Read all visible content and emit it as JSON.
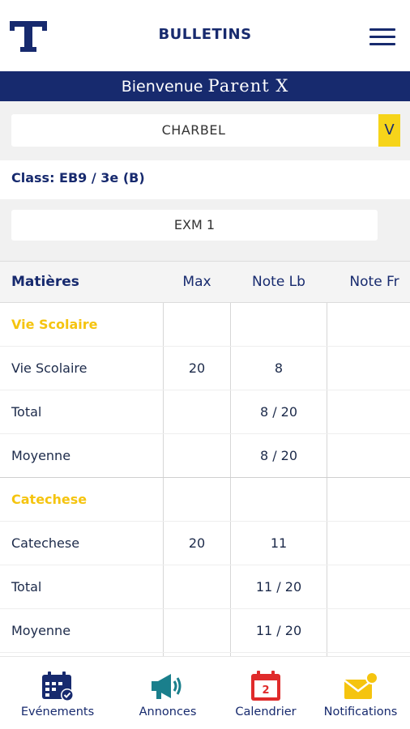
{
  "header": {
    "title": "BULLETINS"
  },
  "welcome": {
    "prefix": "Bienvenue",
    "name": "Parent X"
  },
  "student_select": {
    "value": "CHARBEL",
    "arrow": "V"
  },
  "class_info": "Class: EB9 / 3e (B)",
  "exam_select": {
    "value": "EXM 1"
  },
  "table": {
    "headers": {
      "subject": "Matières",
      "max": "Max",
      "note_lb": "Note Lb",
      "note_fr": "Note Fr"
    },
    "rows": [
      {
        "subject": "Vie Scolaire",
        "max": "",
        "lb": "",
        "fr": "",
        "group": true
      },
      {
        "subject": "Vie Scolaire",
        "max": "20",
        "lb": "8",
        "fr": ""
      },
      {
        "subject": "Total",
        "max": "",
        "lb": "8 / 20",
        "fr": ""
      },
      {
        "subject": "Moyenne",
        "max": "",
        "lb": "8 / 20",
        "fr": "",
        "end": true
      },
      {
        "subject": "Catechese",
        "max": "",
        "lb": "",
        "fr": "",
        "group": true
      },
      {
        "subject": "Catechese",
        "max": "20",
        "lb": "11",
        "fr": ""
      },
      {
        "subject": "Total",
        "max": "",
        "lb": "11 / 20",
        "fr": ""
      },
      {
        "subject": "Moyenne",
        "max": "",
        "lb": "11 / 20",
        "fr": ""
      }
    ]
  },
  "nav": [
    {
      "label": "Evénements",
      "icon": "calendar-check-icon"
    },
    {
      "label": "Annonces",
      "icon": "megaphone-icon"
    },
    {
      "label": "Calendrier",
      "icon": "calendar-day-icon",
      "badge": "2"
    },
    {
      "label": "Notifications",
      "icon": "envelope-icon"
    }
  ],
  "colors": {
    "primary": "#172a6e",
    "accent": "#f5c40f",
    "red": "#e02b2b",
    "teal": "#1a7f8c"
  }
}
